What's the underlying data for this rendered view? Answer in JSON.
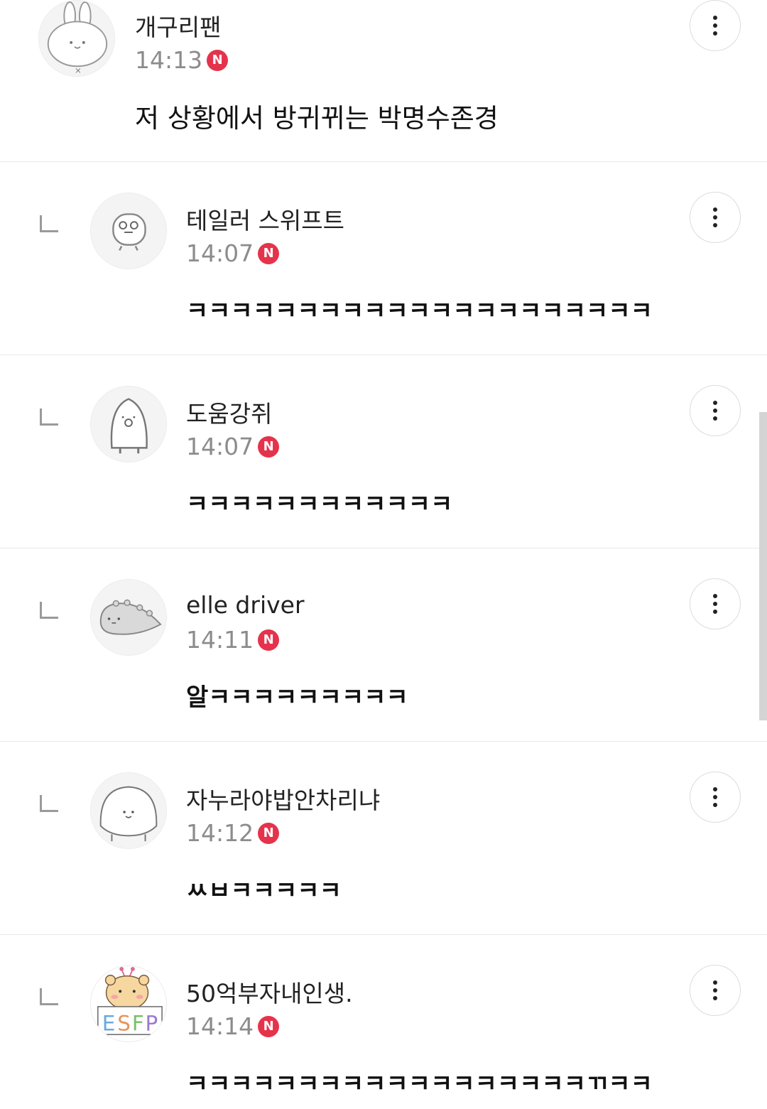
{
  "comments": [
    {
      "nickname": "개구리팬",
      "time": "14:13",
      "badge": "N",
      "text": "저 상황에서 방귀뀌는 박명수존경",
      "avatar": "rabbit-avatar"
    },
    {
      "nickname": "테일러 스위프트",
      "time": "14:07",
      "badge": "N",
      "text": "ㅋㅋㅋㅋㅋㅋㅋㅋㅋㅋㅋㅋㅋㅋㅋㅋㅋㅋㅋㅋㅋ",
      "avatar": "bird-avatar"
    },
    {
      "nickname": "도움강쥐",
      "time": "14:07",
      "badge": "N",
      "text": "ㅋㅋㅋㅋㅋㅋㅋㅋㅋㅋㅋㅋ",
      "avatar": "penguin-avatar"
    },
    {
      "nickname": "elle driver",
      "time": "14:11",
      "badge": "N",
      "text": "알ㅋㅋㅋㅋㅋㅋㅋㅋㅋ",
      "avatar": "dinosaur-avatar"
    },
    {
      "nickname": "자누라야밥안차리냐",
      "time": "14:12",
      "badge": "N",
      "text": "ㅆㅂㅋㅋㅋㅋㅋ",
      "avatar": "blob-avatar"
    },
    {
      "nickname": "50억부자내인생.",
      "time": "14:14",
      "badge": "N",
      "text": "ㅋㅋㅋㅋㅋㅋㅋㅋㅋㅋㅋㅋㅋㅋㅋㅋㅋㅋㄲㅋㅋ",
      "avatar": "bear-esfp-avatar",
      "avatar_text": "ESFP"
    }
  ],
  "colors": {
    "badge": "#e5334b",
    "divider": "#e8e8e8",
    "time": "#8c8c8c"
  }
}
